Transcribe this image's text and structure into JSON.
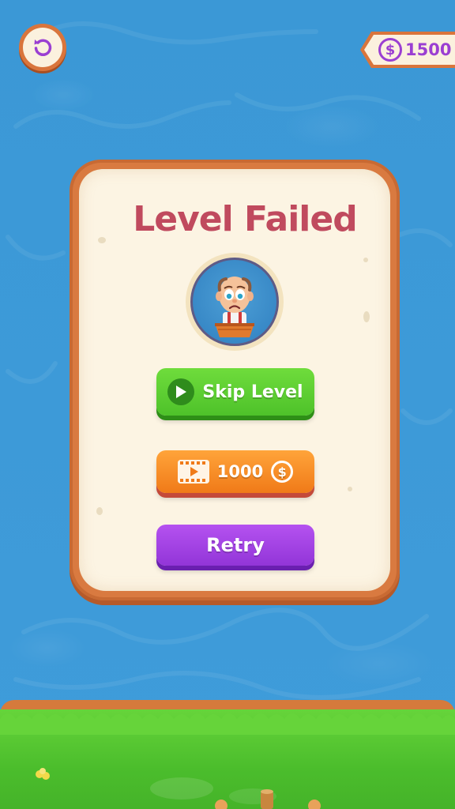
{
  "hud": {
    "restart_icon": "restart-icon",
    "coin_icon": "$",
    "coin_balance": "1500"
  },
  "dialog": {
    "title": "Level Failed",
    "buttons": {
      "skip_label": "Skip Level",
      "ad_cost": "1000",
      "ad_coin_symbol": "$",
      "retry_label": "Retry"
    }
  },
  "colors": {
    "title": "#c04a5e",
    "coin": "#9b3fd2",
    "skip": "#4ec22a",
    "ad": "#f07a18",
    "retry": "#9235d8",
    "frame": "#d97a40",
    "water": "#3d9ad8",
    "grass": "#4bbd2c"
  }
}
